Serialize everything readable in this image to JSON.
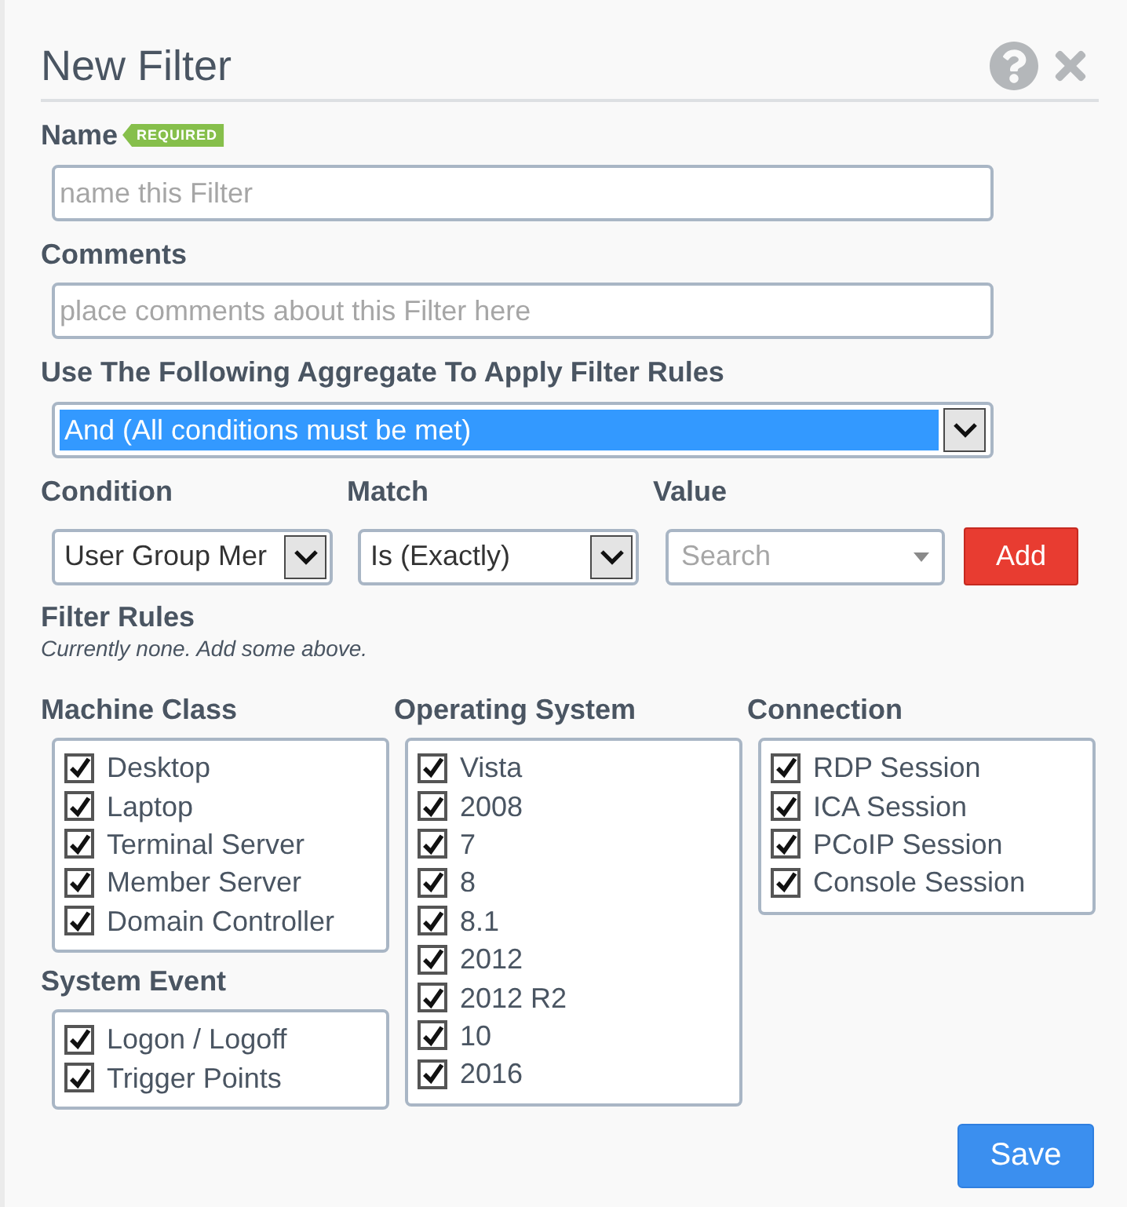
{
  "dialog": {
    "title": "New Filter"
  },
  "name_field": {
    "label": "Name",
    "badge": "REQUIRED",
    "placeholder": "name this Filter"
  },
  "comments_field": {
    "label": "Comments",
    "placeholder": "place comments about this Filter here"
  },
  "aggregate": {
    "label": "Use The Following Aggregate To Apply Filter Rules",
    "value": "And (All conditions must be met)",
    "highlighted": true
  },
  "rule_builder": {
    "condition": {
      "label": "Condition",
      "value": "User Group Mer"
    },
    "match": {
      "label": "Match",
      "value": "Is (Exactly)"
    },
    "value": {
      "label": "Value",
      "placeholder": "Search"
    },
    "add_button": "Add"
  },
  "filter_rules": {
    "label": "Filter Rules",
    "note": "Currently none. Add some above."
  },
  "filter_columns": [
    {
      "groups": [
        {
          "title": "Machine Class",
          "items": [
            {
              "label": "Desktop",
              "checked": true
            },
            {
              "label": "Laptop",
              "checked": true
            },
            {
              "label": "Terminal Server",
              "checked": true
            },
            {
              "label": "Member Server",
              "checked": true
            },
            {
              "label": "Domain Controller",
              "checked": true
            }
          ]
        },
        {
          "title": "System Event",
          "items": [
            {
              "label": "Logon / Logoff",
              "checked": true
            },
            {
              "label": "Trigger Points",
              "checked": true
            }
          ]
        }
      ]
    },
    {
      "groups": [
        {
          "title": "Operating System",
          "items": [
            {
              "label": "Vista",
              "checked": true
            },
            {
              "label": "2008",
              "checked": true
            },
            {
              "label": "7",
              "checked": true
            },
            {
              "label": "8",
              "checked": true
            },
            {
              "label": "8.1",
              "checked": true
            },
            {
              "label": "2012",
              "checked": true
            },
            {
              "label": "2012 R2",
              "checked": true
            },
            {
              "label": "10",
              "checked": true
            },
            {
              "label": "2016",
              "checked": true
            }
          ]
        }
      ]
    },
    {
      "groups": [
        {
          "title": "Connection",
          "items": [
            {
              "label": "RDP Session",
              "checked": true
            },
            {
              "label": "ICA Session",
              "checked": true
            },
            {
              "label": "PCoIP Session",
              "checked": true
            },
            {
              "label": "Console Session",
              "checked": true
            }
          ]
        }
      ]
    }
  ],
  "save_button": "Save"
}
